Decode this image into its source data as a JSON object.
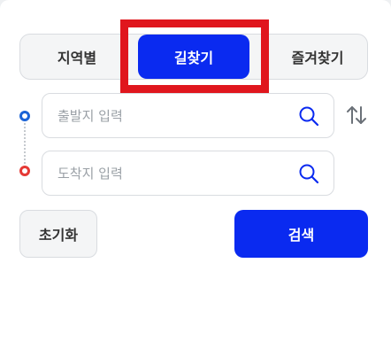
{
  "tabs": {
    "region": "지역별",
    "route": "길찾기",
    "favorites": "즐겨찾기",
    "active": "route"
  },
  "route": {
    "origin_placeholder": "출발지 입력",
    "destination_placeholder": "도착지 입력",
    "origin_value": "",
    "destination_value": ""
  },
  "actions": {
    "reset_label": "초기화",
    "search_label": "검색"
  },
  "icons": {
    "origin_marker": "origin-dot-icon",
    "destination_marker": "destination-dot-icon",
    "search": "search-icon",
    "swap": "swap-icon"
  },
  "colors": {
    "accent": "#0a2af0",
    "highlight": "#e0161d",
    "origin": "#1a63d6",
    "destination": "#e53935"
  }
}
